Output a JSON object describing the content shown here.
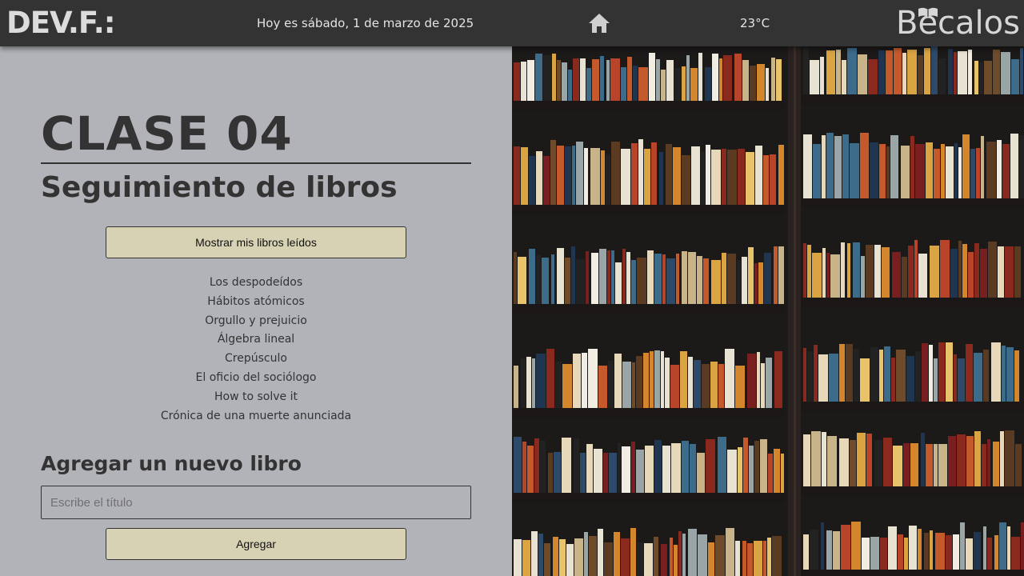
{
  "header": {
    "logo_text": "DEV.F.:",
    "date_text": "Hoy es sábado, 1 de marzo de 2025",
    "home_icon": "home-icon",
    "temperature": "23°C",
    "sponsor_text": "Becalos"
  },
  "main": {
    "class_title": "CLASE 04",
    "subtitle": "Seguimiento de libros",
    "show_button_label": "Mostrar mis libros leídos",
    "books": [
      "Los despodeídos",
      "Hábitos atómicos",
      "Orgullo y prejuicio",
      "Álgebra lineal",
      "Crepúsculo",
      "El oficio del sociólogo",
      "How to solve it",
      "Crónica de una muerte anunciada"
    ],
    "add_heading": "Agregar un nuevo libro",
    "input_placeholder": "Escribe el título",
    "input_value": "",
    "add_button_label": "Agregar"
  },
  "colors": {
    "header_bg": "#333333",
    "panel_bg": "#b2b3b8",
    "button_bg": "#d8d2b4",
    "text_dark": "#333333"
  }
}
